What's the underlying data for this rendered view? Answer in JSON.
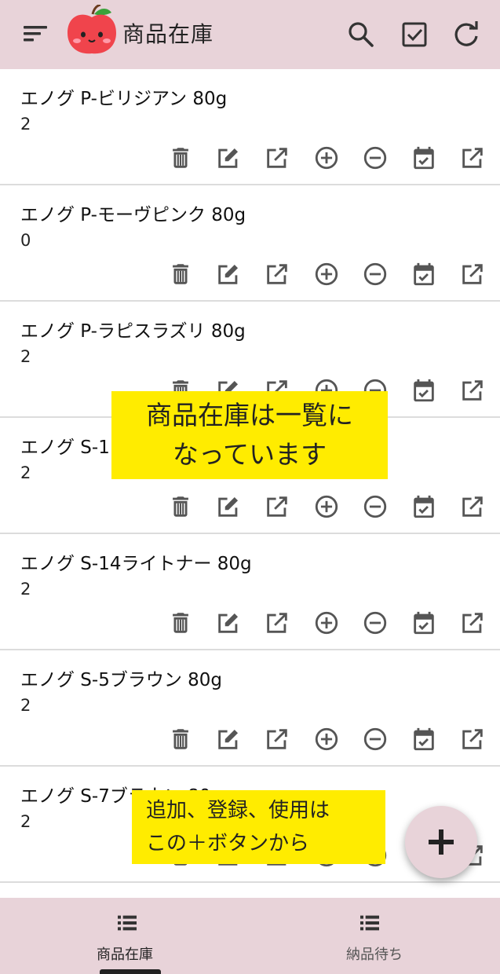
{
  "app": {
    "title": "商品在庫",
    "colors": {
      "bar": "#e8d3d9",
      "icon": "#555555",
      "note": "#ffec00"
    }
  },
  "toolbar": {
    "icons": [
      "sort-menu-icon",
      "search-icon",
      "check-box-icon",
      "refresh-icon"
    ]
  },
  "items": [
    {
      "name": "エノグ P-ビリジアン 80g",
      "qty": "2"
    },
    {
      "name": "エノグ P-モーヴピンク 80g",
      "qty": "0"
    },
    {
      "name": "エノグ P-ラピスラズリ 80g",
      "qty": "2"
    },
    {
      "name": "エノグ S-1",
      "qty": "2"
    },
    {
      "name": "エノグ S-14ライトナー 80g",
      "qty": "2"
    },
    {
      "name": "エノグ S-5ブラウン 80g",
      "qty": "2"
    },
    {
      "name": "エノグ S-7ブラウン 80g",
      "qty": "2"
    }
  ],
  "row_actions": [
    "delete-icon",
    "edit-icon",
    "open-external-icon",
    "add-circle-icon",
    "remove-circle-icon",
    "event-available-icon",
    "open-external-icon"
  ],
  "annotations": {
    "note1": [
      "商品在庫は一覧に",
      "なっています"
    ],
    "note2": [
      "追加、登録、使用は",
      "この＋ボタンから"
    ]
  },
  "bottom_nav": {
    "tabs": [
      {
        "label": "商品在庫",
        "active": true
      },
      {
        "label": "納品待ち",
        "active": false
      }
    ]
  }
}
